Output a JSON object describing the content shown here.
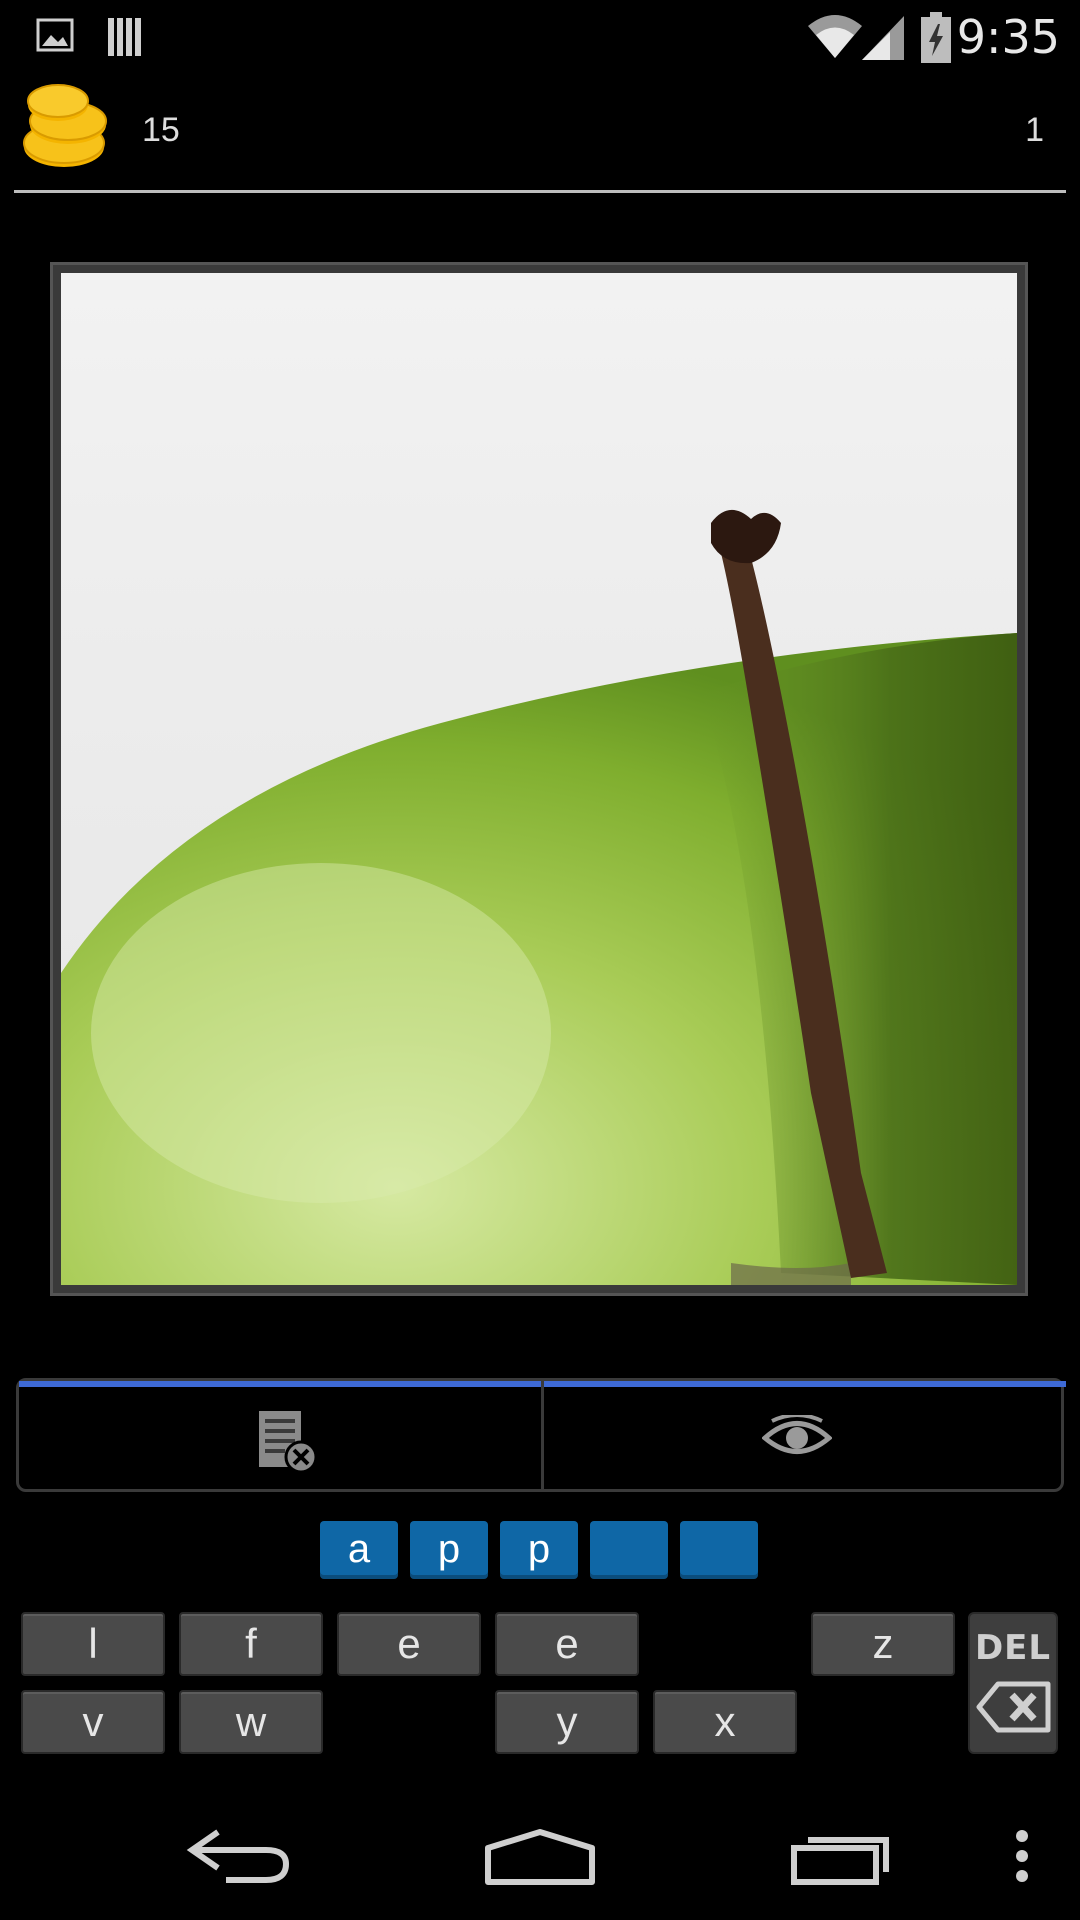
{
  "status_bar": {
    "time": "9:35",
    "left_icons": [
      "gallery-notification-icon",
      "barcode-notification-icon"
    ],
    "right_icons": [
      "wifi-icon",
      "signal-icon",
      "battery-charging-icon"
    ]
  },
  "header": {
    "coins": "15",
    "level": "1",
    "coin_icon": "coins-icon"
  },
  "puzzle": {
    "image_subject": "green apple stem close-up"
  },
  "hints": [
    {
      "icon": "remove-letters-icon"
    },
    {
      "icon": "reveal-letter-eye-icon"
    }
  ],
  "answer_slots": [
    "a",
    "p",
    "p",
    "",
    ""
  ],
  "keyboard": {
    "row1": [
      "l",
      "f",
      "e",
      "e",
      "",
      "z"
    ],
    "row2": [
      "v",
      "w",
      "",
      "y",
      "x",
      ""
    ],
    "delete_label": "DEL"
  },
  "nav_bar": {
    "buttons": [
      "back-icon",
      "home-icon",
      "recents-icon",
      "menu-icon"
    ]
  },
  "colors": {
    "slot_blue": "#0f67a6",
    "accent_blue": "#3e6ad6",
    "coin_gold": "#f4b400"
  }
}
